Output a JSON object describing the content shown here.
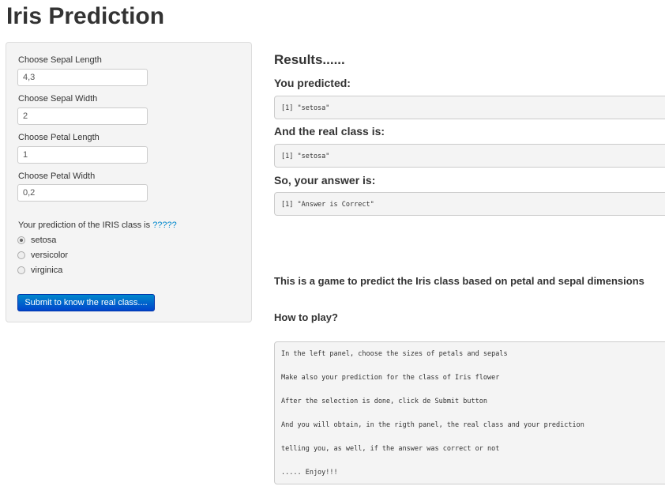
{
  "title": "Iris Prediction",
  "sidebar": {
    "inputs": [
      {
        "label": "Choose Sepal Length",
        "value": "4,3"
      },
      {
        "label": "Choose Sepal Width",
        "value": "2"
      },
      {
        "label": "Choose Petal Length",
        "value": "1"
      },
      {
        "label": "Choose Petal Width",
        "value": "0,2"
      }
    ],
    "prediction_label": "Your prediction of the IRIS class is ",
    "prediction_q": "?????",
    "options": [
      {
        "label": "setosa",
        "selected": true
      },
      {
        "label": "versicolor",
        "selected": false
      },
      {
        "label": "virginica",
        "selected": false
      }
    ],
    "submit_label": "Submit to know the real class...."
  },
  "main": {
    "results_title": "Results......",
    "predicted_label": "You predicted:",
    "predicted_value": "[1] \"setosa\"",
    "real_label": "And the real class is:",
    "real_value": "[1] \"setosa\"",
    "answer_label": "So, your answer is:",
    "answer_value": "[1] \"Answer is Correct\"",
    "description": "This is a game to predict the Iris class based on petal and sepal dimensions",
    "how_to_title": "How to play?",
    "instructions": [
      "In the left panel, choose the sizes of petals and sepals",
      "Make also your prediction for the class of Iris flower",
      "After the selection is done, click de Submit button",
      "And you will obtain, in the rigth panel, the real class and your prediction",
      "telling you, as well, if the answer was correct or not",
      "..... Enjoy!!!"
    ]
  }
}
